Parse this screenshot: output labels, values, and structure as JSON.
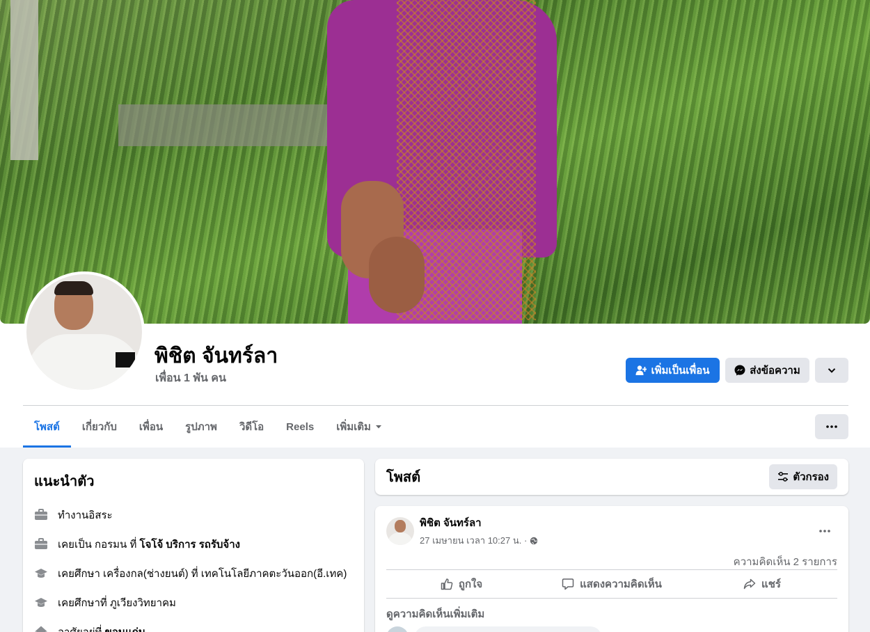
{
  "profile": {
    "name": "พิชิต จันทร์ลา",
    "friends": "เพื่อน 1 พัน คน"
  },
  "actions": {
    "add_friend": "เพิ่มเป็นเพื่อน",
    "message": "ส่งข้อความ"
  },
  "tabs": [
    {
      "label": "โพสต์",
      "active": true
    },
    {
      "label": "เกี่ยวกับ"
    },
    {
      "label": "เพื่อน"
    },
    {
      "label": "รูปภาพ"
    },
    {
      "label": "วิดีโอ"
    },
    {
      "label": "Reels"
    },
    {
      "label": "เพิ่มเติม"
    }
  ],
  "intro": {
    "title": "แนะนำตัว",
    "items": [
      {
        "icon": "briefcase-icon",
        "text": "ทำงานอิสระ",
        "bold": ""
      },
      {
        "icon": "briefcase-icon",
        "text": "เคยเป็น กอรมน ที่ ",
        "bold": "โจโจ้ บริการ รถรับจ้าง"
      },
      {
        "icon": "graduation-cap-icon",
        "text": "เคยศึกษา เครื่องกล(ช่างยนต์) ที่ เทคโนโลยีภาคตะวันออก(อี.เทค)",
        "bold": ""
      },
      {
        "icon": "graduation-cap-icon",
        "text": "เคยศึกษาที่ ภูเวียงวิทยาคม",
        "bold": ""
      },
      {
        "icon": "home-icon",
        "text": "อาศัยอยู่ที่ ",
        "bold": "ขอนแก่น"
      }
    ]
  },
  "posts": {
    "title": "โพสต์",
    "filter_label": "ตัวกรอง"
  },
  "post": {
    "author": "พิชิต จันทร์ลา",
    "timestamp": "27 เมษายน เวลา 10:27 น. ·",
    "comment_count": "ความคิดเห็น 2 รายการ",
    "like": "ถูกใจ",
    "comment": "แสดงความคิดเห็น",
    "share": "แชร์",
    "more_comments": "ดูความคิดเห็นเพิ่มเติม"
  },
  "colors": {
    "accent": "#1b74e4",
    "secondary_bg": "#e4e6eb",
    "muted_text": "#65676b",
    "page_bg": "#f0f2f5"
  }
}
